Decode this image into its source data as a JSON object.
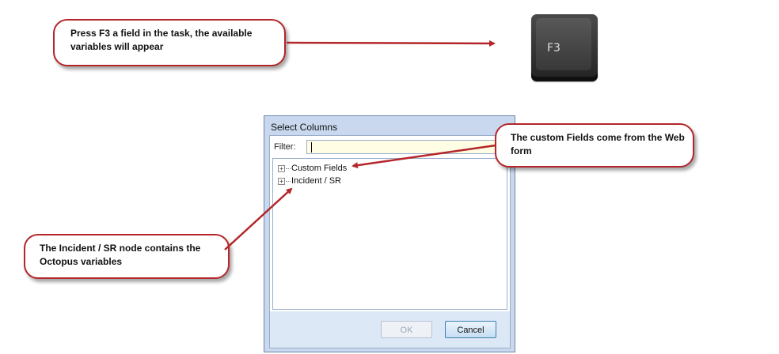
{
  "callouts": {
    "f3": "Press F3 a field in the task, the available variables will appear",
    "custom_fields": "The custom Fields come from the Web form",
    "incident": "The Incident / SR node contains the Octopus variables"
  },
  "key": {
    "label": "F3"
  },
  "dialog": {
    "title": "Select Columns",
    "filter_label": "Filter:",
    "filter_value": "",
    "tree": [
      {
        "label": "Custom Fields",
        "icon": "plus-expander-icon"
      },
      {
        "label": "Incident / SR",
        "icon": "plus-expander-icon"
      }
    ],
    "ok_label": "OK",
    "cancel_label": "Cancel"
  },
  "colors": {
    "annotation_red": "#b3262a",
    "dialog_frame": "#c9d8ee",
    "filter_background": "#fffde3"
  }
}
